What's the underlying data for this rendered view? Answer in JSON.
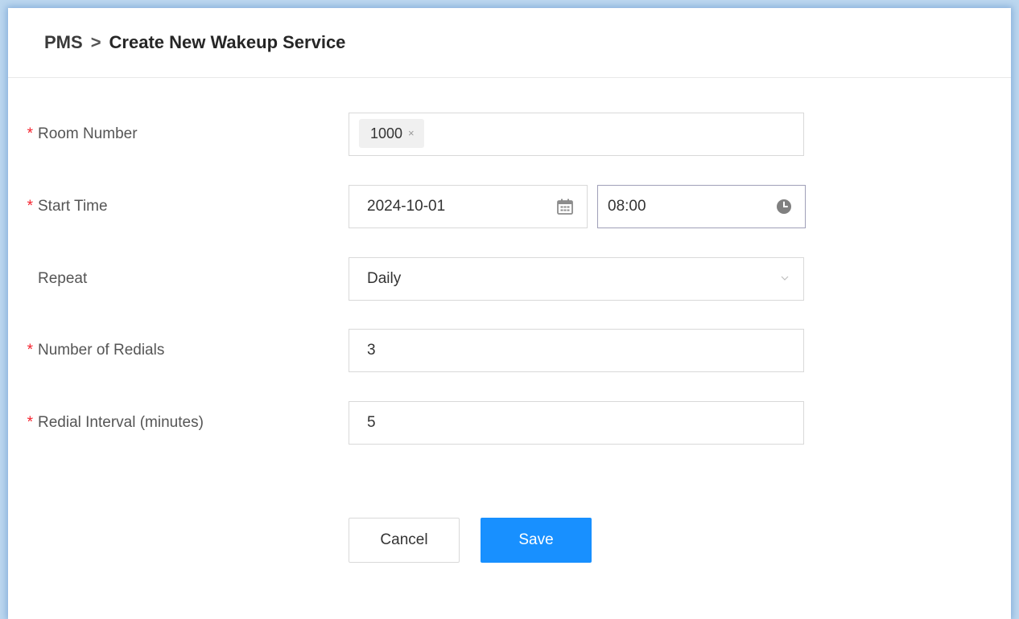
{
  "breadcrumb": {
    "root": "PMS",
    "separator": ">",
    "current": "Create New Wakeup Service"
  },
  "form": {
    "required_marker": "*",
    "room_number": {
      "label": "Room Number",
      "required": true,
      "tags": [
        "1000"
      ],
      "tag_remove": "×"
    },
    "start_time": {
      "label": "Start Time",
      "required": true,
      "date": "2024-10-01",
      "time": "08:00"
    },
    "repeat": {
      "label": "Repeat",
      "required": false,
      "selected": "Daily"
    },
    "redials": {
      "label": "Number of Redials",
      "required": true,
      "value": "3"
    },
    "redial_interval": {
      "label": "Redial Interval (minutes)",
      "required": true,
      "value": "5"
    }
  },
  "buttons": {
    "cancel": "Cancel",
    "save": "Save"
  },
  "colors": {
    "primary": "#1890ff",
    "required": "#f5222d"
  },
  "icons": [
    "calendar-icon",
    "clock-icon",
    "chevron-down-icon",
    "chevron-right-icon",
    "close-icon"
  ]
}
